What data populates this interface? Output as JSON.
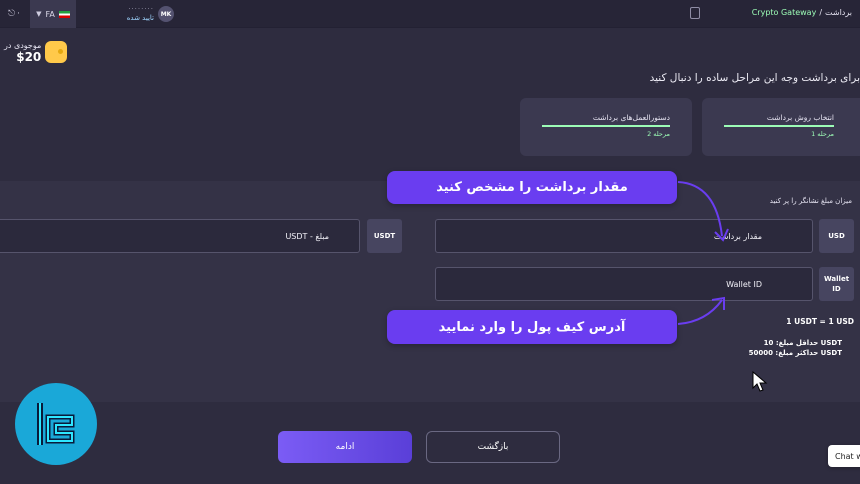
{
  "header": {
    "language": "FA",
    "user_initials": "MK",
    "user_status": "تایید شده",
    "breadcrumb_section": "برداشت",
    "breadcrumb_separator": "/",
    "breadcrumb_active": "Crypto Gateway"
  },
  "balance": {
    "label": "موجودی در",
    "amount": "$20"
  },
  "page": {
    "heading": "برای برداشت وجه این مراحل ساده را دنبال کنید"
  },
  "steps": [
    {
      "title": "انتخاب روش برداشت",
      "subtitle": "مرحله 1",
      "progress": 1.0
    },
    {
      "title": "دستورالعمل‌های برداشت",
      "subtitle": "مرحله 2",
      "progress": 1.0
    }
  ],
  "form": {
    "instruction": "میزان مبلغ نشانگر را پر کنید",
    "usd_tag": "USD",
    "amount_placeholder": "مقدار برداشت",
    "usdt_tag": "USDT",
    "usdt_amount_label": "USDT - مبلغ",
    "wallet_tag_line1": "Wallet",
    "wallet_tag_line2": "ID",
    "wallet_placeholder": "Wallet ID",
    "rate": "1 USDT = 1 USD",
    "min_amount": "حداقل مبلغ: 10 USDT",
    "max_amount": "حداکثر مبلغ: 50000 USDT"
  },
  "callouts": {
    "amount": "مقدار برداشت را مشخص کنید",
    "wallet": "آدرس کیف پول را وارد نمایید"
  },
  "buttons": {
    "continue": "ادامه",
    "back": "بازگشت",
    "chat": "Chat w"
  },
  "colors": {
    "accent": "#7b5cf5",
    "progress": "#9cfcb6",
    "callout": "#6a3df0",
    "logo": "#1aa8d8"
  }
}
